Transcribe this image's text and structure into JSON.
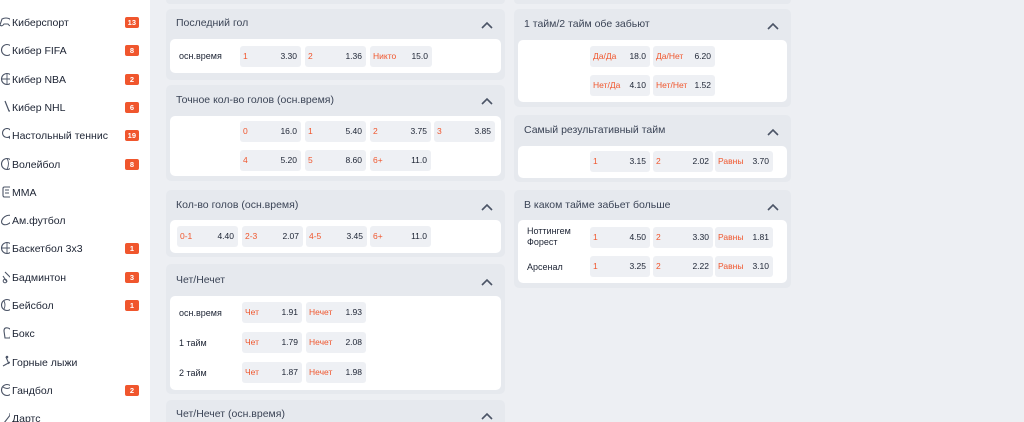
{
  "sidebar": {
    "items": [
      {
        "label": "Киберспорт",
        "badge": "13",
        "icon": "gamepad-icon"
      },
      {
        "label": "Кибер FIFA",
        "badge": "8",
        "icon": "soccer-ball-icon"
      },
      {
        "label": "Кибер NBA",
        "badge": "2",
        "icon": "basketball-icon"
      },
      {
        "label": "Кибер NHL",
        "badge": "6",
        "icon": "hockey-icon"
      },
      {
        "label": "Настольный теннис",
        "badge": "19",
        "icon": "table-tennis-icon"
      },
      {
        "label": "Волейбол",
        "badge": "8",
        "icon": "volleyball-icon"
      },
      {
        "label": "MMA",
        "badge": "",
        "icon": "mma-icon"
      },
      {
        "label": "Ам.футбол",
        "badge": "",
        "icon": "american-football-icon"
      },
      {
        "label": "Баскетбол 3х3",
        "badge": "1",
        "icon": "basketball-icon"
      },
      {
        "label": "Бадминтон",
        "badge": "3",
        "icon": "badminton-icon"
      },
      {
        "label": "Бейсбол",
        "badge": "1",
        "icon": "baseball-icon"
      },
      {
        "label": "Бокс",
        "badge": "",
        "icon": "boxing-icon"
      },
      {
        "label": "Горные лыжи",
        "badge": "",
        "icon": "skiing-icon"
      },
      {
        "label": "Гандбол",
        "badge": "2",
        "icon": "handball-icon"
      },
      {
        "label": "Дартс",
        "badge": "",
        "icon": "darts-icon"
      }
    ]
  },
  "accent_color": "#f0562d",
  "markets": {
    "last_goal": {
      "title": "Последний гол",
      "row_label": "осн.время",
      "odds": [
        {
          "name": "1",
          "value": "3.30"
        },
        {
          "name": "2",
          "value": "1.36"
        },
        {
          "name": "Никто",
          "value": "15.0"
        }
      ]
    },
    "exact_goals": {
      "title": "Точное кол-во голов (осн.время)",
      "odds": [
        {
          "name": "0",
          "value": "16.0"
        },
        {
          "name": "1",
          "value": "5.40"
        },
        {
          "name": "2",
          "value": "3.75"
        },
        {
          "name": "3",
          "value": "3.85"
        },
        {
          "name": "4",
          "value": "5.20"
        },
        {
          "name": "5",
          "value": "8.60"
        },
        {
          "name": "6+",
          "value": "11.0"
        }
      ]
    },
    "goal_count": {
      "title": "Кол-во голов (осн.время)",
      "odds": [
        {
          "name": "0-1",
          "value": "4.40"
        },
        {
          "name": "2-3",
          "value": "2.07"
        },
        {
          "name": "4-5",
          "value": "3.45"
        },
        {
          "name": "6+",
          "value": "11.0"
        }
      ]
    },
    "odd_even": {
      "title": "Чет/Нечет",
      "rows": [
        {
          "label": "осн.время",
          "odd_name": "Чет",
          "odd_value": "1.91",
          "even_name": "Нечет",
          "even_value": "1.93"
        },
        {
          "label": "1 тайм",
          "odd_name": "Чет",
          "odd_value": "1.79",
          "even_name": "Нечет",
          "even_value": "2.08"
        },
        {
          "label": "2 тайм",
          "odd_name": "Чет",
          "odd_value": "1.87",
          "even_name": "Нечет",
          "even_value": "1.98"
        }
      ]
    },
    "odd_even_main": {
      "title": "Чет/Нечет (осн.время)"
    },
    "both_score_halves": {
      "title": "1 тайм/2 тайм обе забьют",
      "odds": [
        {
          "name": "Да/Да",
          "value": "18.0"
        },
        {
          "name": "Да/Нет",
          "value": "6.20"
        },
        {
          "name": "Нет/Да",
          "value": "4.10"
        },
        {
          "name": "Нет/Нет",
          "value": "1.52"
        }
      ]
    },
    "top_half": {
      "title": "Самый результативный тайм",
      "odds": [
        {
          "name": "1",
          "value": "3.15"
        },
        {
          "name": "2",
          "value": "2.02"
        },
        {
          "name": "Равны",
          "value": "3.70"
        }
      ]
    },
    "team_half": {
      "title": "В каком тайме забьет больше",
      "rows": [
        {
          "team": "Ноттингем Форест",
          "o1": "4.50",
          "o2": "3.30",
          "draw": "1.81"
        },
        {
          "team": "Арсенал",
          "o1": "3.25",
          "o2": "2.22",
          "draw": "3.10"
        }
      ],
      "n1": "1",
      "n2": "2",
      "n3": "Равны"
    }
  }
}
